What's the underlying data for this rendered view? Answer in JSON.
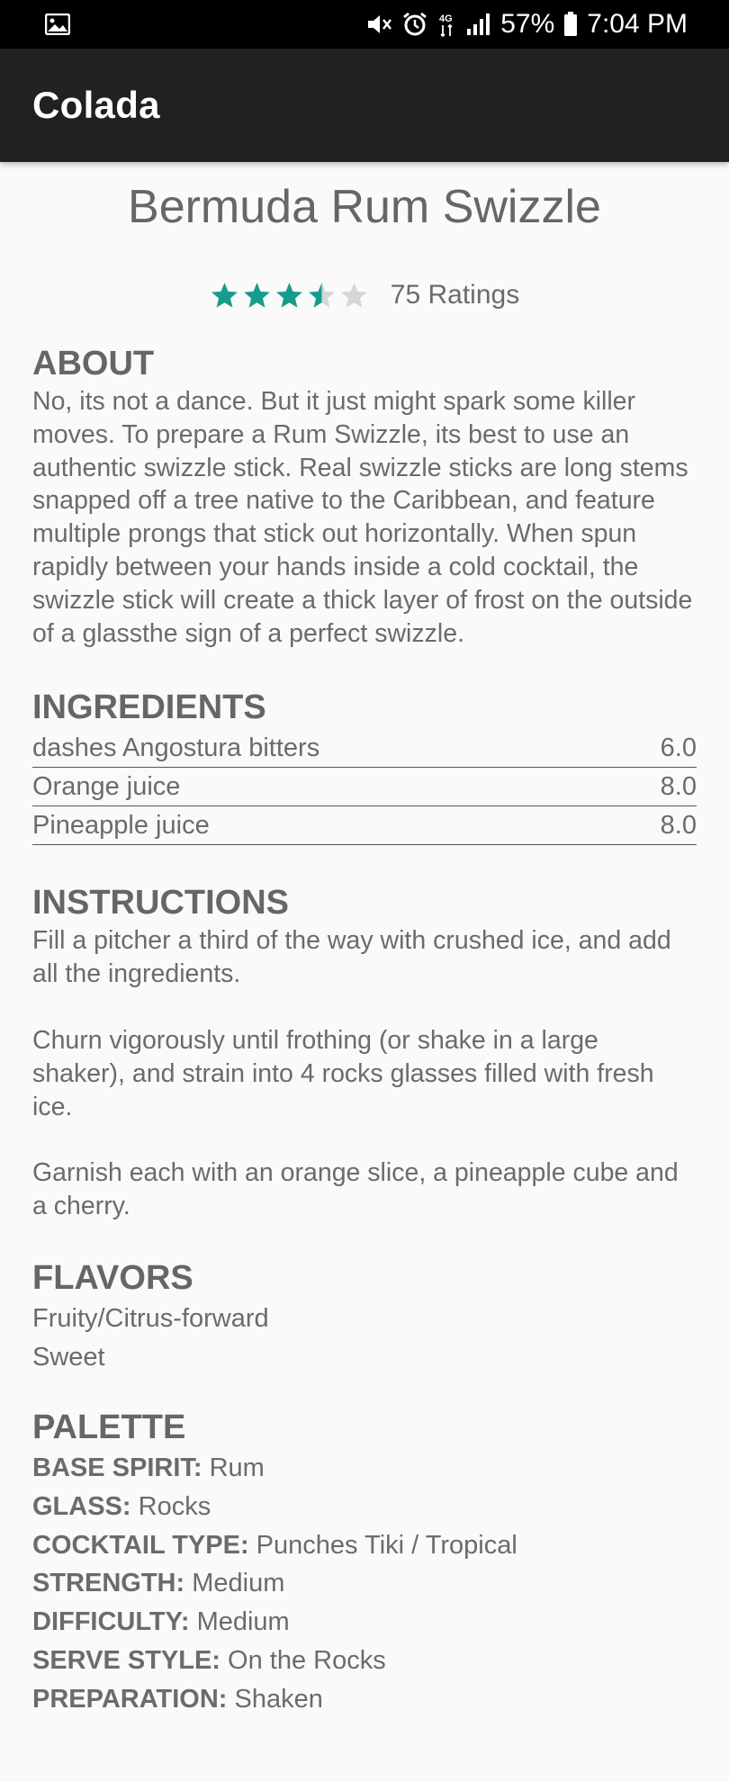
{
  "status_bar": {
    "battery_percent": "57%",
    "time": "7:04 PM",
    "icons": [
      "image-icon",
      "mute-icon",
      "alarm-icon",
      "lte-icon",
      "signal-icon",
      "battery-icon"
    ]
  },
  "app_bar": {
    "title": "Colada"
  },
  "drink": {
    "title": "Bermuda Rum Swizzle",
    "rating_value": 3.5,
    "rating_max": 5,
    "ratings_label": "75 Ratings"
  },
  "about": {
    "heading": "ABOUT",
    "text": "No, its not a dance. But it just might spark some killer moves. To prepare a Rum Swizzle, its best to use an authentic swizzle stick. Real swizzle sticks are long stems snapped off a tree native to the Caribbean, and feature multiple prongs that stick out horizontally. When spun rapidly between your hands inside a cold cocktail, the swizzle stick will create a thick layer of frost on the outside of a glassthe sign of a perfect swizzle."
  },
  "ingredients": {
    "heading": "INGREDIENTS",
    "items": [
      {
        "name": "dashes Angostura bitters",
        "amount": "6.0"
      },
      {
        "name": "Orange juice",
        "amount": "8.0"
      },
      {
        "name": "Pineapple juice",
        "amount": "8.0"
      }
    ]
  },
  "instructions": {
    "heading": "INSTRUCTIONS",
    "paragraphs": [
      "Fill a pitcher a third of the way with crushed ice, and add all the ingredients.",
      "Churn vigorously until frothing (or shake in a large shaker), and strain into 4 rocks glasses filled with fresh ice.",
      "Garnish each with an orange slice, a pineapple cube and a cherry."
    ]
  },
  "flavors": {
    "heading": "FLAVORS",
    "items": [
      "Fruity/Citrus-forward",
      "Sweet"
    ]
  },
  "palette": {
    "heading": "PALETTE",
    "rows": [
      {
        "label": "BASE SPIRIT:",
        "value": "Rum"
      },
      {
        "label": "GLASS:",
        "value": "Rocks"
      },
      {
        "label": "COCKTAIL TYPE:",
        "value": "Punches Tiki / Tropical"
      },
      {
        "label": "STRENGTH:",
        "value": "Medium"
      },
      {
        "label": "DIFFICULTY:",
        "value": "Medium"
      },
      {
        "label": "SERVE STYLE:",
        "value": "On the Rocks"
      },
      {
        "label": "PREPARATION:",
        "value": "Shaken"
      }
    ]
  },
  "colors": {
    "star_filled": "#169c8c",
    "star_empty": "#d6d6d6",
    "app_bar": "#212121",
    "status_bar": "#000000",
    "background": "#fafafa",
    "text": "#6b6b6b"
  }
}
